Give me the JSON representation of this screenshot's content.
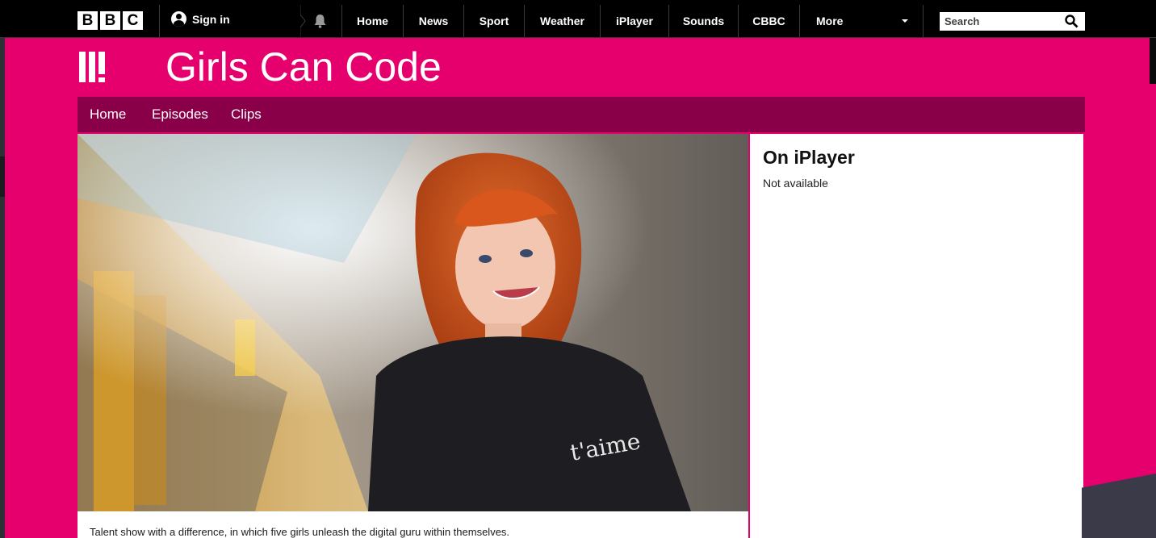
{
  "topbar": {
    "logo": [
      "B",
      "B",
      "C"
    ],
    "signin_label": "Sign in",
    "nav": [
      "Home",
      "News",
      "Sport",
      "Weather",
      "iPlayer",
      "Sounds",
      "CBBC",
      "More"
    ],
    "search_placeholder": "Search"
  },
  "brand": {
    "title": "Girls Can Code"
  },
  "programme_nav": [
    "Home",
    "Episodes",
    "Clips"
  ],
  "hero": {
    "caption": "Talent show with a difference, in which five girls unleash the digital guru within themselves.",
    "shirt_text": "t'aime"
  },
  "side": {
    "heading": "On iPlayer",
    "status": "Not available"
  },
  "colors": {
    "brand": "#e5006e",
    "nav_bg": "#8a0048",
    "topbar": "#000000"
  }
}
